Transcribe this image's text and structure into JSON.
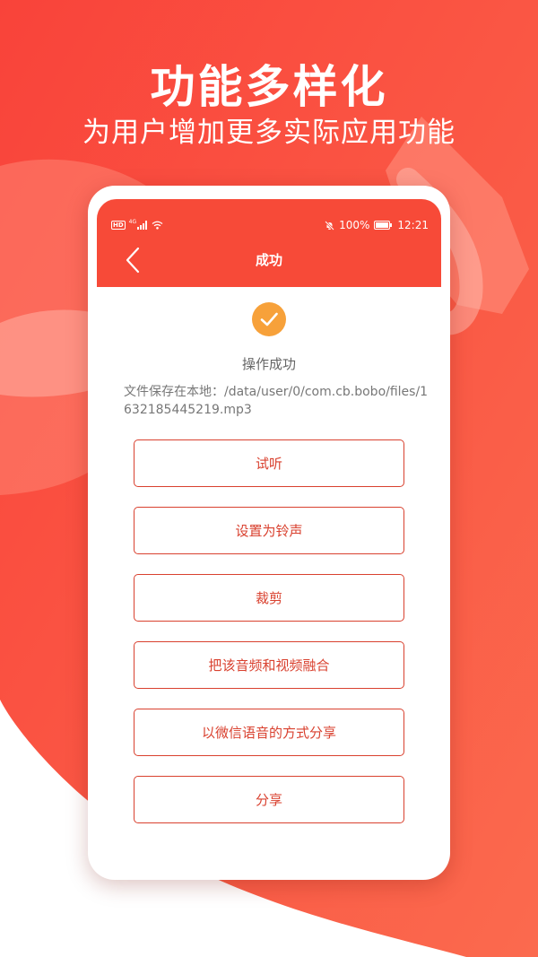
{
  "promo": {
    "headline": "功能多样化",
    "subheadline": "为用户增加更多实际应用功能"
  },
  "status_bar": {
    "hd_badge": "HD",
    "network": "4G",
    "battery": "100%",
    "time": "12:21"
  },
  "app_bar": {
    "title": "成功"
  },
  "result": {
    "message": "操作成功",
    "file_path": "文件保存在本地：/data/user/0/com.cb.bobo/files/1632185445219.mp3"
  },
  "actions": [
    {
      "label": "试听"
    },
    {
      "label": "设置为铃声"
    },
    {
      "label": "裁剪"
    },
    {
      "label": "把该音频和视频融合"
    },
    {
      "label": "以微信语音的方式分享"
    },
    {
      "label": "分享"
    }
  ],
  "colors": {
    "brand_red": "#f74a38",
    "success_orange": "#f7a13a",
    "button_text": "#d9412f"
  }
}
